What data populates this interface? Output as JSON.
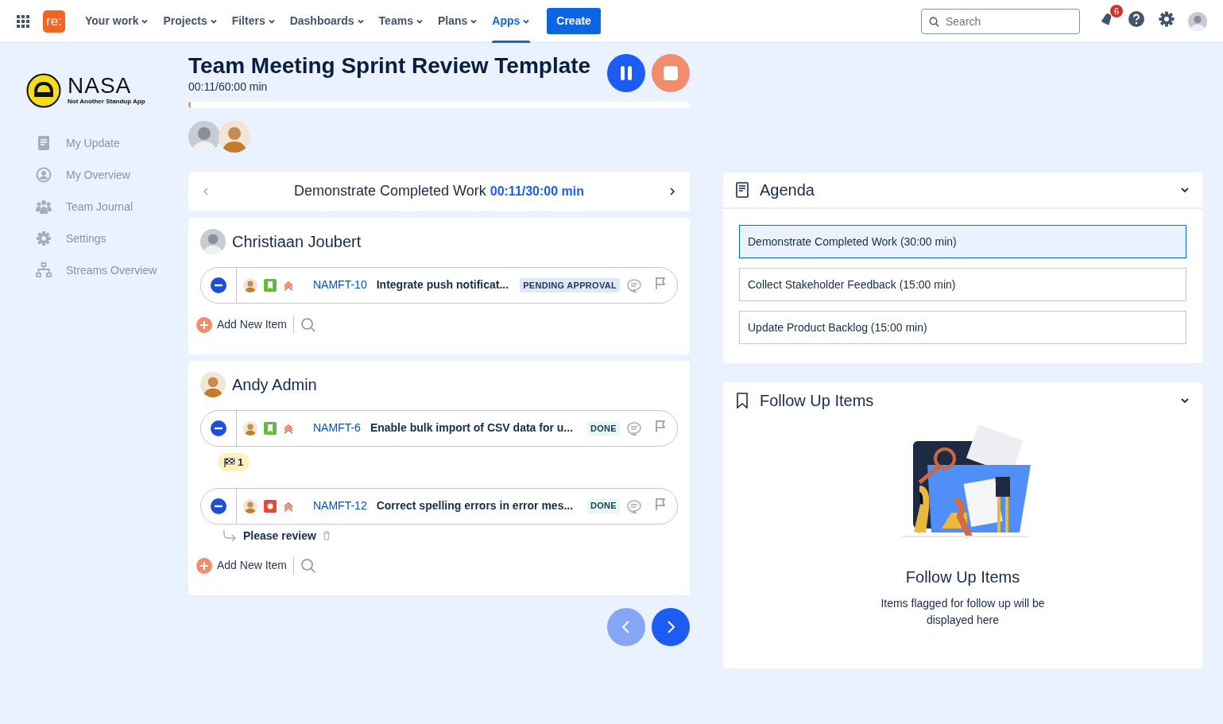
{
  "topnav": {
    "logo_text": "re:",
    "menus": [
      {
        "label": "Your work",
        "selected": false
      },
      {
        "label": "Projects",
        "selected": false
      },
      {
        "label": "Filters",
        "selected": false
      },
      {
        "label": "Dashboards",
        "selected": false
      },
      {
        "label": "Teams",
        "selected": false
      },
      {
        "label": "Plans",
        "selected": false
      },
      {
        "label": "Apps",
        "selected": true
      }
    ],
    "create_label": "Create",
    "search": {
      "placeholder": "Search"
    },
    "notification_count": "6"
  },
  "sidebar": {
    "logo_title": "NASA",
    "logo_subtitle": "Not Another Standup App",
    "items": [
      {
        "kind": "document",
        "label": "My Update"
      },
      {
        "kind": "person",
        "label": "My Overview"
      },
      {
        "kind": "team",
        "label": "Team Journal"
      },
      {
        "kind": "gear",
        "label": "Settings"
      },
      {
        "kind": "hierarchy",
        "label": "Streams Overview"
      }
    ]
  },
  "meeting": {
    "title": "Team Meeting Sprint Review Template",
    "elapsed": "00:11/60:00 min",
    "level": 0.003,
    "participants": [
      {
        "kind": "photo"
      },
      {
        "kind": "cartoon"
      }
    ]
  },
  "section_nav": {
    "title": "Demonstrate Completed Work",
    "time": "00:11/30:00 min"
  },
  "members": [
    {
      "name": "Christiaan Joubert",
      "avatar": {
        "kind": "photo"
      },
      "add_label": "Add New Item",
      "items": [
        {
          "kind": "story",
          "key": "NAMFT-10",
          "summary": "Integrate push notificat...",
          "status": {
            "label": "PENDING APPROVAL",
            "kind": "pending"
          }
        }
      ]
    },
    {
      "name": "Andy Admin",
      "avatar": {
        "kind": "cartoon"
      },
      "add_label": "Add New Item",
      "items": [
        {
          "kind": "story",
          "key": "NAMFT-6",
          "summary": "Enable bulk import of CSV data for u...",
          "status": {
            "label": "DONE",
            "kind": "done"
          },
          "flag_count": "1"
        },
        {
          "kind": "bug",
          "key": "NAMFT-12",
          "summary": "Correct spelling errors in error mes...",
          "status": {
            "label": "DONE",
            "kind": "done"
          },
          "note": "Please review"
        }
      ]
    }
  ],
  "pager": [
    {
      "kind": "prev",
      "disabled": true
    },
    {
      "kind": "next",
      "disabled": false
    }
  ],
  "agenda": {
    "title": "Agenda",
    "items": [
      {
        "label": "Demonstrate Completed Work (30:00 min)",
        "selected": true
      },
      {
        "label": "Collect Stakeholder Feedback (15:00 min)",
        "selected": false
      },
      {
        "label": "Update Product Backlog (15:00 min)",
        "selected": false
      }
    ]
  },
  "follow_up": {
    "title": "Follow Up Items",
    "empty_title": "Follow Up Items",
    "empty_text": "Items flagged for follow up will be displayed here"
  }
}
